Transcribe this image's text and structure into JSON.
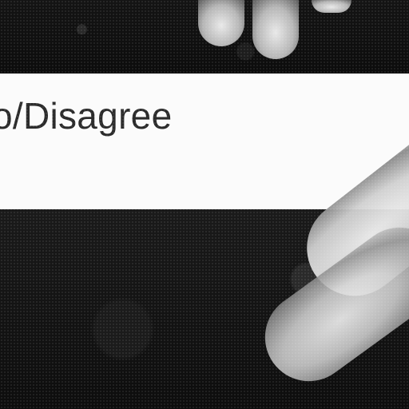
{
  "caption": {
    "text": "o/Disagree"
  }
}
